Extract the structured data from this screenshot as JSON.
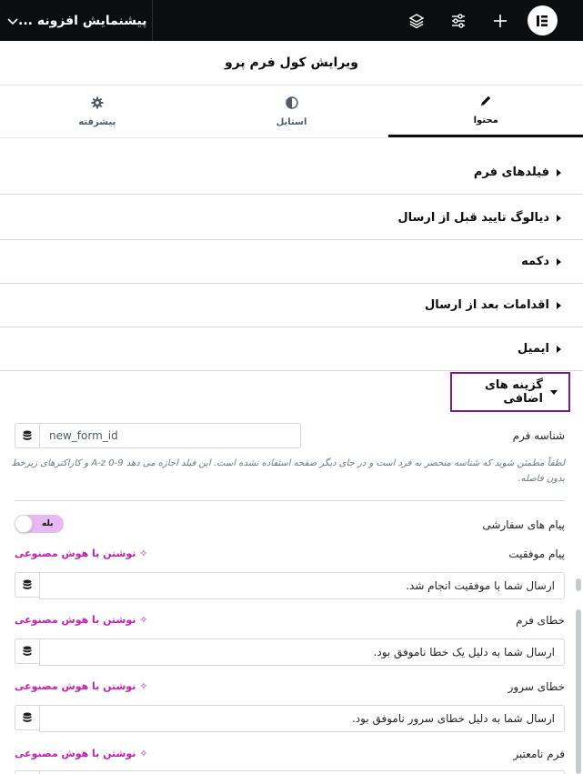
{
  "topbar": {
    "preview_title": "پیشنمایش افزونه ...",
    "icons": [
      "chevron-down-icon",
      "layers-icon",
      "sliders-icon",
      "plus-icon",
      "elementor-logo-icon"
    ]
  },
  "panel": {
    "title": "ویرایش کول فرم پرو"
  },
  "tabs": [
    {
      "label": "محتوا",
      "icon": "pencil-icon",
      "active": true
    },
    {
      "label": "استایل",
      "icon": "contrast-icon",
      "active": false
    },
    {
      "label": "پیشرفته",
      "icon": "gear-icon",
      "active": false
    }
  ],
  "sections": [
    {
      "label": "فیلدهای فرم"
    },
    {
      "label": "دیالوگ تایید قبل از ارسال"
    },
    {
      "label": "دکمه"
    },
    {
      "label": "اقدامات بعد از ارسال"
    },
    {
      "label": "ایمیل"
    },
    {
      "label": "گزینه های اضافی",
      "expanded": true
    }
  ],
  "form_id": {
    "label": "شناسه فرم",
    "value": "new_form_id",
    "help": "لطفاً مطمئن شوید که شناسه منحصر به فرد است و در جای دیگر صفحه استفاده نشده است. این فیلد اجازه می دهد ‎A-z 0-9‎ و کاراکترهای زیرخط بدون فاصله."
  },
  "custom_messages": {
    "label": "پیام های سفارشی",
    "toggle_label": "بله",
    "enabled": true
  },
  "ai_write_label": "✧ نوشتن با هوش مصنوعی",
  "messages": [
    {
      "label": "پیام موفقیت",
      "value": "ارسال شما با موفقیت انجام شد."
    },
    {
      "label": "خطای فرم",
      "value": "ارسال شما به دلیل یک خطا ناموفق بود."
    },
    {
      "label": "خطای سرور",
      "value": "ارسال شما به دلیل خطای سرور ناموفق بود."
    },
    {
      "label": "فرم نامعتبر",
      "value": ""
    }
  ],
  "colors": {
    "accent": "#c11fb1",
    "highlight_border": "#7b1a82",
    "toggle_bg": "#e7b9f2",
    "topbar_bg": "#0c0d0e"
  }
}
